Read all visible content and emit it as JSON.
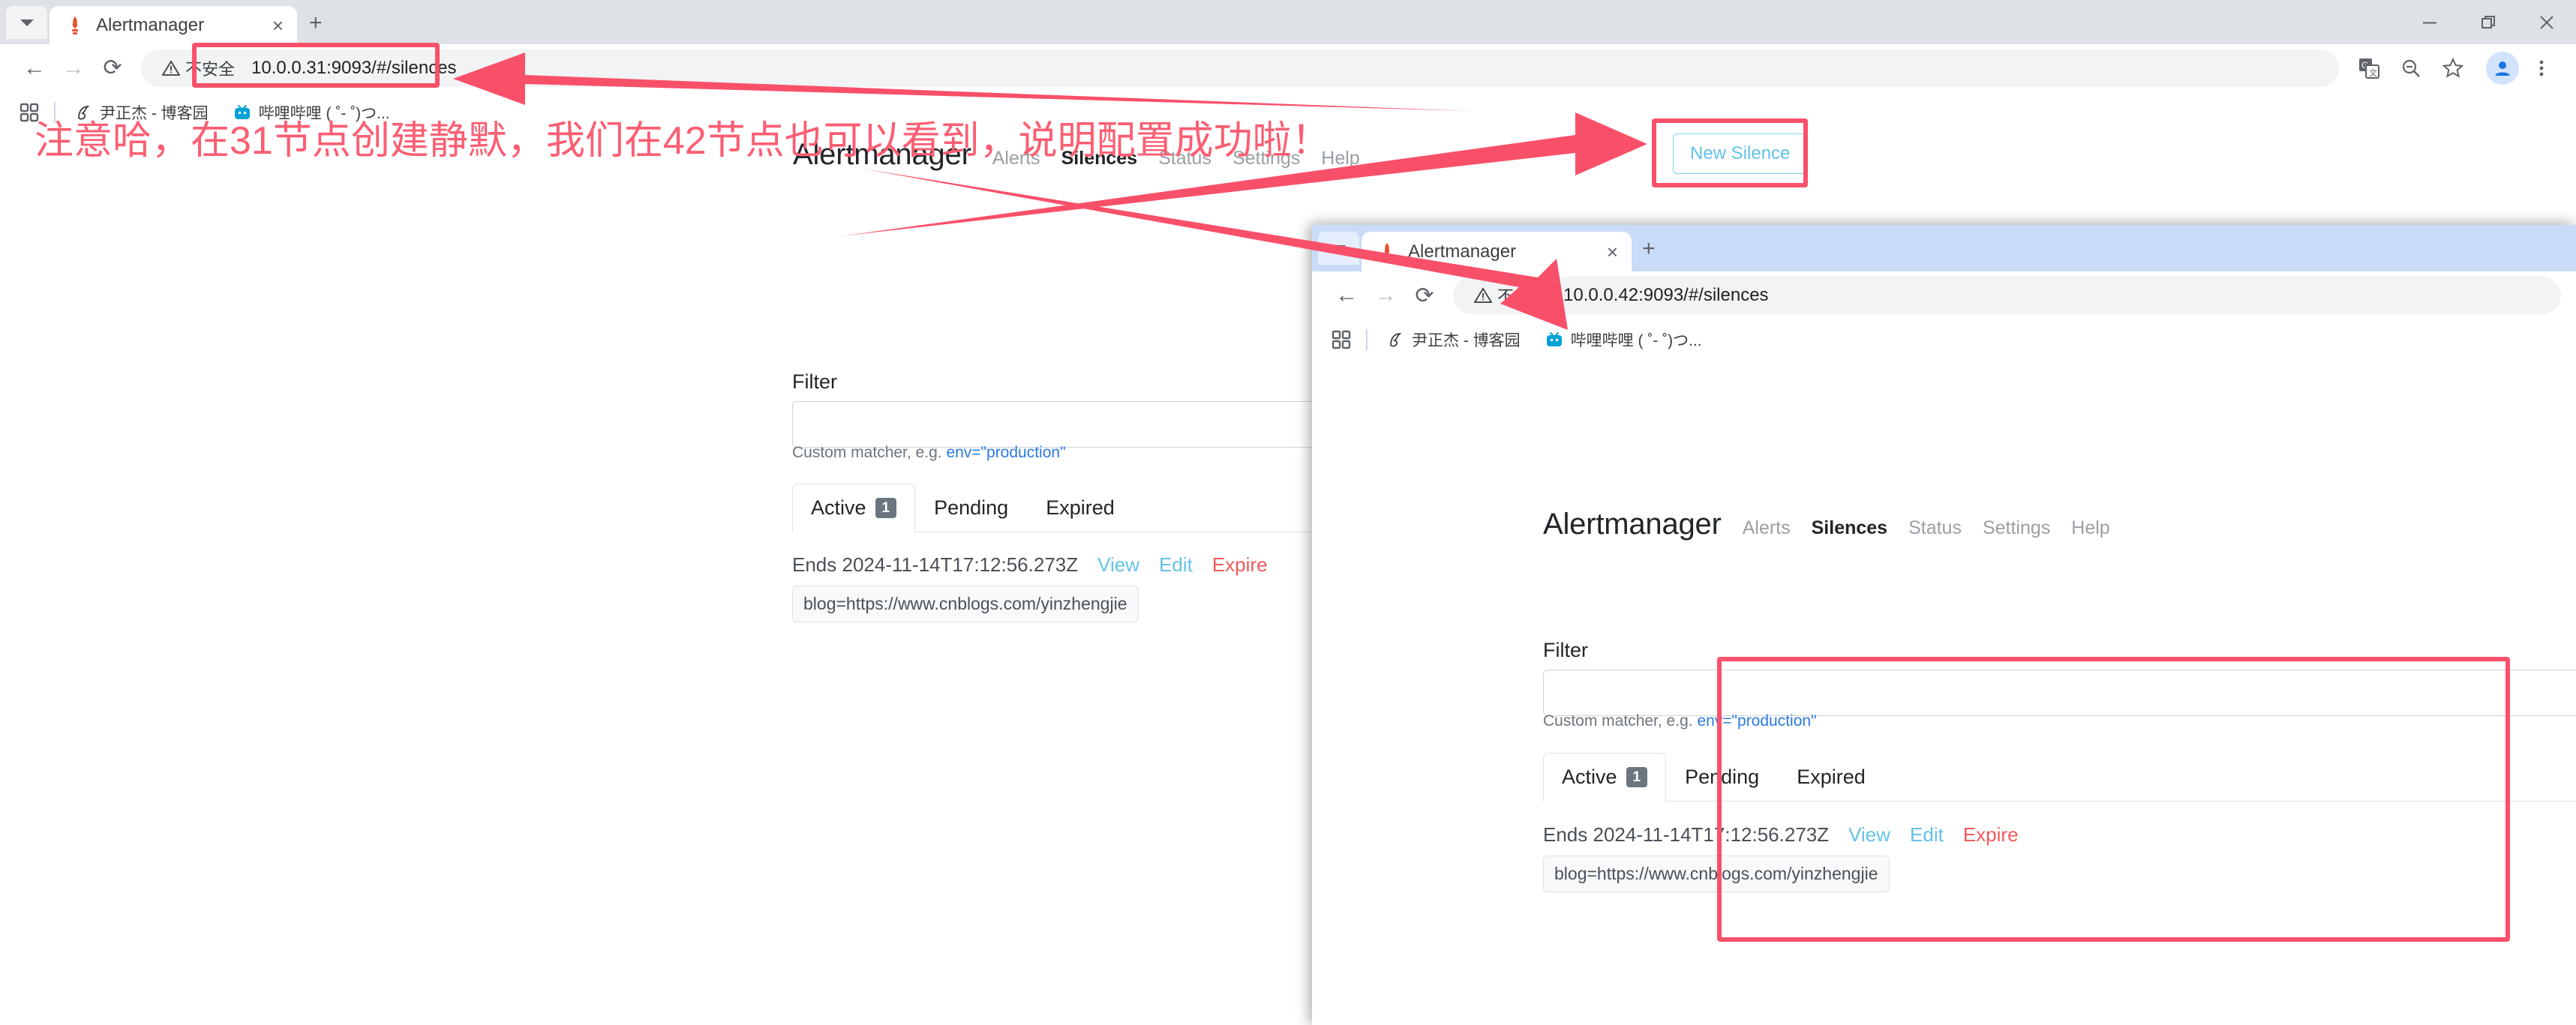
{
  "window1": {
    "tab": {
      "title": "Alertmanager",
      "favicon": "alertmanager-torch-icon",
      "close": "×",
      "new_tab": "+"
    },
    "window_controls": {
      "minimize": "minimize-icon",
      "maximize": "maximize-icon",
      "close": "close-icon"
    },
    "toolbar": {
      "back": "←",
      "forward": "→",
      "reload": "⟳",
      "security_label": "不安全",
      "url": "10.0.0.31:9093/#/silences",
      "translate": "translate-icon",
      "zoom": "zoom-out-icon",
      "bookmark": "star-icon",
      "profile": "avatar-icon",
      "menu": "kebab-menu-icon"
    },
    "bookmarks": {
      "apps": "apps-grid-icon",
      "items": [
        {
          "label": "尹正杰 - 博客园",
          "favicon": "cnblogs-icon"
        },
        {
          "label": "哔哩哔哩 ( ˚- ˚)つ...",
          "favicon": "bilibili-icon"
        }
      ]
    },
    "page": {
      "brand": "Alertmanager",
      "nav": [
        {
          "label": "Alerts",
          "active": false
        },
        {
          "label": "Silences",
          "active": true
        },
        {
          "label": "Status",
          "active": false
        },
        {
          "label": "Settings",
          "active": false
        },
        {
          "label": "Help",
          "active": false
        }
      ],
      "new_silence_label": "New Silence",
      "filter_label": "Filter",
      "filter_value": "",
      "filter_placeholder": "",
      "hint_prefix": "Custom matcher, e.g.",
      "hint_code": "env=\"production\"",
      "tabs": [
        {
          "label": "Active",
          "count": "1",
          "active": true
        },
        {
          "label": "Pending",
          "count": null,
          "active": false
        },
        {
          "label": "Expired",
          "count": null,
          "active": false
        }
      ],
      "silences": [
        {
          "ends": "Ends 2024-11-14T17:12:56.273Z",
          "actions": [
            {
              "label": "View",
              "kind": "view"
            },
            {
              "label": "Edit",
              "kind": "edit"
            },
            {
              "label": "Expire",
              "kind": "expire"
            }
          ],
          "matchers": [
            "blog=https://www.cnblogs.com/yinzhengjie"
          ]
        }
      ]
    }
  },
  "window2": {
    "tab": {
      "title": "Alertmanager",
      "favicon": "alertmanager-torch-icon",
      "close": "×",
      "new_tab": "+"
    },
    "toolbar": {
      "back": "←",
      "forward": "→",
      "reload": "⟳",
      "security_label": "不安全",
      "url": "10.0.0.42:9093/#/silences"
    },
    "bookmarks": {
      "apps": "apps-grid-icon",
      "items": [
        {
          "label": "尹正杰 - 博客园",
          "favicon": "cnblogs-icon"
        },
        {
          "label": "哔哩哔哩 ( ˚- ˚)つ...",
          "favicon": "bilibili-icon"
        }
      ]
    },
    "page": {
      "brand": "Alertmanager",
      "nav": [
        {
          "label": "Alerts",
          "active": false
        },
        {
          "label": "Silences",
          "active": true
        },
        {
          "label": "Status",
          "active": false
        },
        {
          "label": "Settings",
          "active": false
        },
        {
          "label": "Help",
          "active": false
        }
      ],
      "filter_label": "Filter",
      "filter_value": "",
      "filter_placeholder": "",
      "hint_prefix": "Custom matcher, e.g.",
      "hint_code": "env=\"production\"",
      "tabs": [
        {
          "label": "Active",
          "count": "1",
          "active": true
        },
        {
          "label": "Pending",
          "count": null,
          "active": false
        },
        {
          "label": "Expired",
          "count": null,
          "active": false
        }
      ],
      "silences": [
        {
          "ends": "Ends 2024-11-14T17:12:56.273Z",
          "actions": [
            {
              "label": "View",
              "kind": "view"
            },
            {
              "label": "Edit",
              "kind": "edit"
            },
            {
              "label": "Expire",
              "kind": "expire"
            }
          ],
          "matchers": [
            "blog=https://www.cnblogs.com/yinzhengjie"
          ]
        }
      ]
    }
  },
  "annotations": {
    "note_text": "注意哈，在31节点创建静默，我们在42节点也可以看到，说明配置成功啦！",
    "color": "#fb5e72",
    "boxes": [
      {
        "name": "highlight-url-window1"
      },
      {
        "name": "highlight-new-silence-button"
      },
      {
        "name": "highlight-silences-list-window2"
      }
    ],
    "arrows": [
      {
        "name": "arrow-to-url-window1"
      },
      {
        "name": "arrow-to-new-silence-button"
      },
      {
        "name": "arrow-to-window2-url"
      }
    ]
  }
}
